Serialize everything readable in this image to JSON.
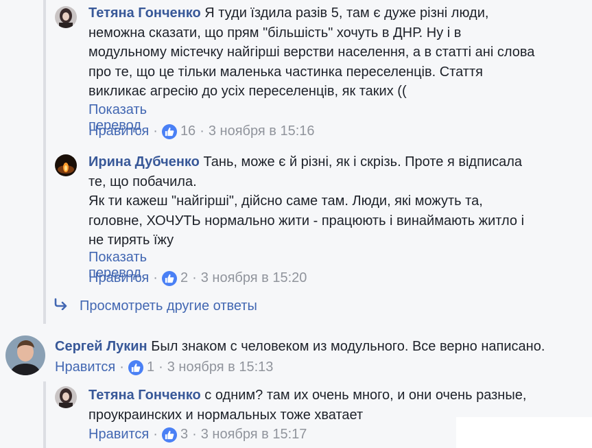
{
  "comments": [
    {
      "author": "Тетяна Гонченко",
      "lines": [
        "Я туди їздила разів 5, там є дуже різні люди,",
        "неможна сказати, що прям \"більшість\" хочуть в ДНР. Ну і в",
        "модульному містечку найгірші верстви населення, а в статті ані слова",
        "про те, що це тільки маленька частинка переселенців. Стаття",
        "викликає агресію до усіх переселенців, як таких (("
      ],
      "translate": "Показать перевод",
      "like": "Нравится",
      "count": "16",
      "time": "3 ноября в 15:16"
    },
    {
      "author": "Ирина Дубченко",
      "lines": [
        "Тань, може є й різні, як і скрізь. Проте я відписала",
        "те, що побачила.",
        "Як ти кажеш \"найгірші\", дійсно саме там. Люди, які можуть та,",
        "головне, ХОЧУТЬ нормально жити - працюють і винаймають житло і",
        "не тирять їжу"
      ],
      "translate": "Показать перевод",
      "like": "Нравится",
      "count": "2",
      "time": "3 ноября в 15:20"
    },
    {
      "author": "Сергей Лукин",
      "lines": [
        "Был знаком с человеком из модульного. Все верно написано."
      ],
      "like": "Нравится",
      "count": "1",
      "time": "3 ноября в 15:13"
    },
    {
      "author": "Тетяна Гонченко",
      "lines": [
        "с одним? там их очень много, и они очень разные,",
        "проукраинских и нормальных тоже хватает"
      ],
      "like": "Нравится",
      "count": "3",
      "time": "3 ноября в 15:17"
    }
  ],
  "more_replies": "Просмотреть другие ответы",
  "icons": {
    "like": "thumbs-up-icon",
    "reply_arrow": "reply-arrow-icon"
  },
  "colors": {
    "link": "#385898",
    "blue": "#4267b2",
    "meta": "#90949c",
    "like_badge": "#4a80f5"
  }
}
